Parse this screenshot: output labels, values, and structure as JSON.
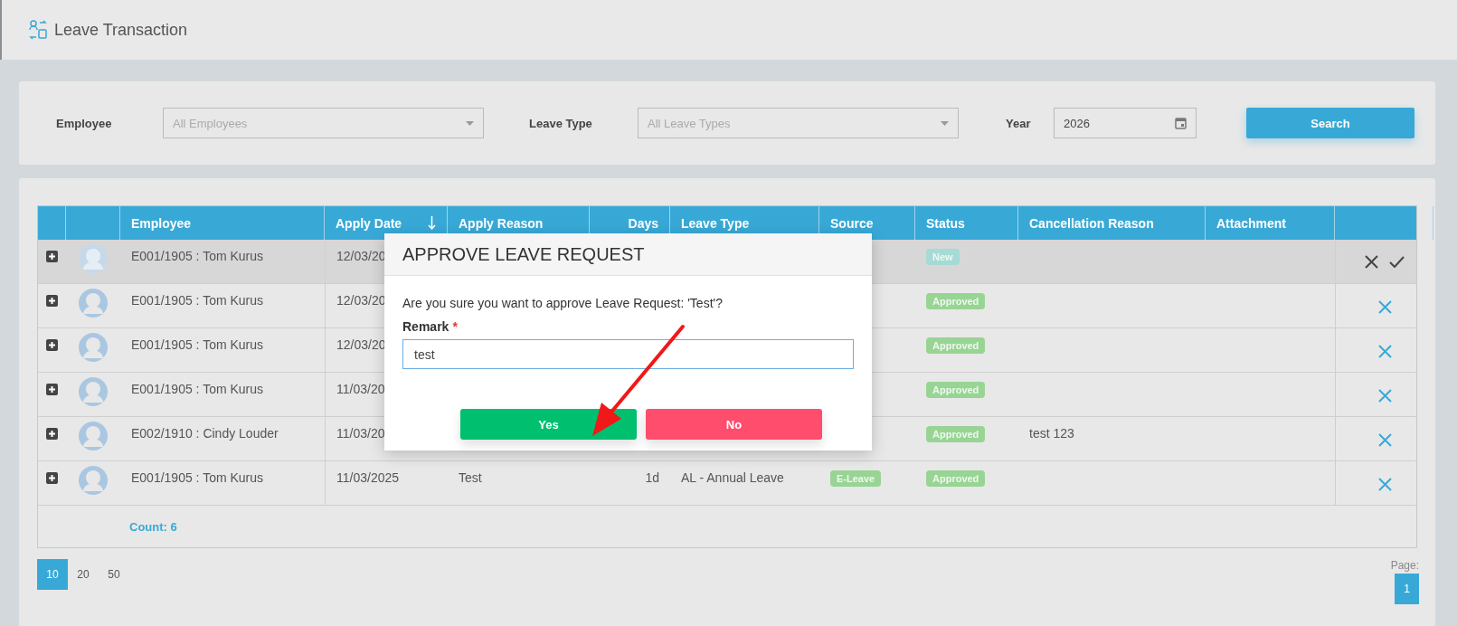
{
  "header": {
    "title": "Leave Transaction"
  },
  "filters": {
    "employee": {
      "label": "Employee",
      "placeholder": "All Employees"
    },
    "leave_type": {
      "label": "Leave Type",
      "placeholder": "All Leave Types"
    },
    "year": {
      "label": "Year",
      "value": "2026"
    },
    "search_button": "Search"
  },
  "table": {
    "columns": [
      {
        "label": "Employee",
        "sorted": false
      },
      {
        "label": "Apply Date",
        "sorted": true
      },
      {
        "label": "Apply Reason",
        "sorted": false
      },
      {
        "label": "Days",
        "sorted": false
      },
      {
        "label": "Leave Type",
        "sorted": false
      },
      {
        "label": "Source",
        "sorted": false
      },
      {
        "label": "Status",
        "sorted": false
      },
      {
        "label": "Cancellation Reason",
        "sorted": false
      },
      {
        "label": "Attachment",
        "sorted": false
      }
    ],
    "rows": [
      {
        "employee": "E001/1905 : Tom Kurus",
        "apply_date": "12/03/20",
        "status": {
          "label": "New",
          "color": "#a6dad6"
        },
        "selected": true,
        "kind": "pending"
      },
      {
        "employee": "E001/1905 : Tom Kurus",
        "apply_date": "12/03/20",
        "status": {
          "label": "Approved",
          "color": "#98d494"
        },
        "selected": false,
        "kind": "approved"
      },
      {
        "employee": "E001/1905 : Tom Kurus",
        "apply_date": "12/03/20",
        "status": {
          "label": "Approved",
          "color": "#98d494"
        },
        "selected": false,
        "kind": "approved"
      },
      {
        "employee": "E001/1905 : Tom Kurus",
        "apply_date": "11/03/20",
        "status": {
          "label": "Approved",
          "color": "#98d494"
        },
        "selected": false,
        "kind": "approved"
      },
      {
        "employee": "E002/1910 : Cindy Louder",
        "apply_date": "11/03/20",
        "status": {
          "label": "Approved",
          "color": "#98d494"
        },
        "cancellation_reason": "test 123",
        "selected": false,
        "kind": "approved"
      },
      {
        "employee": "E001/1905 : Tom Kurus",
        "apply_date": "11/03/2025",
        "apply_reason": "Test",
        "days": "1d",
        "leave_type": "AL - Annual Leave",
        "source": "E-Leave",
        "status": {
          "label": "Approved",
          "color": "#98d494"
        },
        "selected": false,
        "kind": "approved"
      }
    ],
    "count": "Count: 6"
  },
  "pagination": {
    "page_sizes": [
      {
        "label": "10",
        "selected": true
      },
      {
        "label": "20",
        "selected": false
      },
      {
        "label": "50",
        "selected": false
      }
    ],
    "page_label": "Page:",
    "pages": [
      {
        "label": "1",
        "selected": true
      }
    ]
  },
  "modal": {
    "title": "APPROVE LEAVE REQUEST",
    "message": "Are you sure you want to approve Leave Request: 'Test'?",
    "remark": {
      "label": "Remark",
      "required": true,
      "required_mark": "*",
      "value": "test"
    },
    "buttons": [
      {
        "label": "Yes",
        "kind": "confirm"
      },
      {
        "label": "No",
        "kind": "cancel"
      }
    ]
  }
}
